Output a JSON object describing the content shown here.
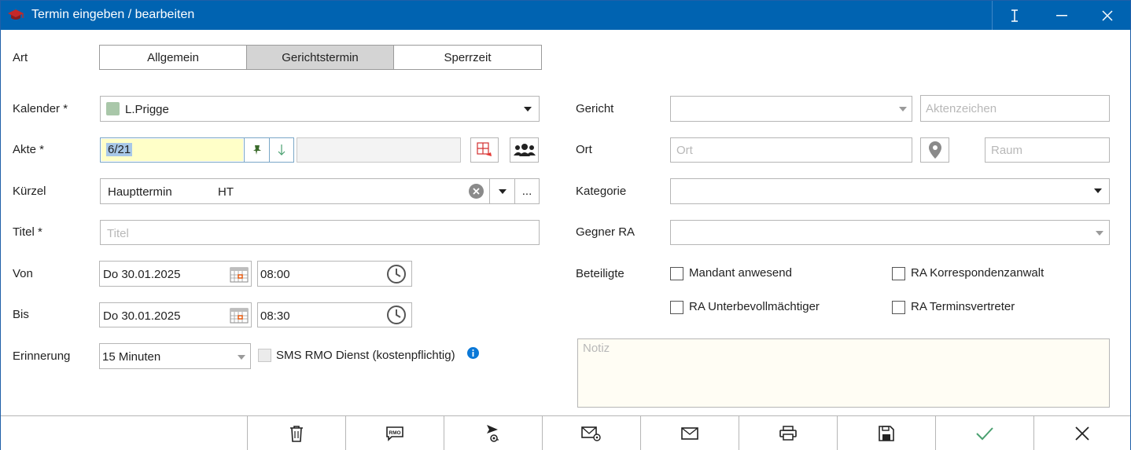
{
  "window": {
    "title": "Termin eingeben / bearbeiten",
    "icons": [
      "app-graduation-cap-icon",
      "text-cursor-icon",
      "minimize-icon",
      "close-icon"
    ]
  },
  "art": {
    "label": "Art",
    "tabs": [
      {
        "label": "Allgemein",
        "active": false
      },
      {
        "label": "Gerichtstermin",
        "active": true
      },
      {
        "label": "Sperrzeit",
        "active": false
      }
    ]
  },
  "kalender": {
    "label": "Kalender *",
    "value": "L.Prigge",
    "color": "#a9c7a9"
  },
  "akte": {
    "label": "Akte *",
    "value": "6/21",
    "highlight": "#ffffc8"
  },
  "kuerzel": {
    "label": "Kürzel",
    "name": "Haupttermin",
    "code": "HT",
    "more": "..."
  },
  "titel": {
    "label": "Titel *",
    "placeholder": "Titel"
  },
  "von": {
    "label": "Von",
    "date": "Do 30.01.2025",
    "time": "08:00"
  },
  "bis": {
    "label": "Bis",
    "date": "Do 30.01.2025",
    "time": "08:30"
  },
  "erinnerung": {
    "label": "Erinnerung",
    "value": "15 Minuten",
    "sms_label": "SMS RMO Dienst (kostenpflichtig)"
  },
  "gericht": {
    "label": "Gericht",
    "aktenzeichen_placeholder": "Aktenzeichen"
  },
  "ort": {
    "label": "Ort",
    "placeholder": "Ort",
    "raum_placeholder": "Raum"
  },
  "kategorie": {
    "label": "Kategorie"
  },
  "gegner": {
    "label": "Gegner RA"
  },
  "beteiligte": {
    "label": "Beteiligte",
    "options": [
      "Mandant anwesend",
      "RA Korrespondenzanwalt",
      "RA Unterbevollmächtiger",
      "RA Terminsvertreter"
    ]
  },
  "notiz": {
    "placeholder": "Notiz",
    "bg": "#fffdf4"
  },
  "toolbar": {
    "rmo_text": "RMO",
    "items": [
      "delete-icon",
      "rmo-sms-icon",
      "send-at-icon",
      "email-attach-icon",
      "email-icon",
      "print-icon",
      "save-icon",
      "confirm-icon",
      "cancel-icon"
    ],
    "accent": "#4aa070"
  }
}
